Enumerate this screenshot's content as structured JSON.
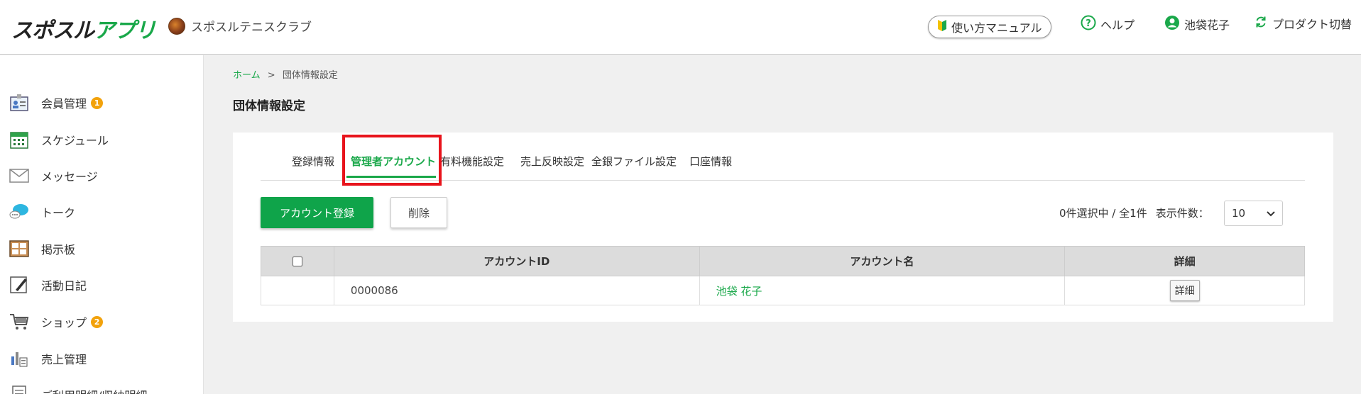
{
  "header": {
    "logo_main": "スポスル",
    "logo_accent": "アプリ",
    "club_name": "スポスルテニスクラブ",
    "manual_label": "使い方マニュアル",
    "help_label": "ヘルプ",
    "user_name": "池袋花子",
    "switch_label": "プロダクト切替"
  },
  "sidebar": {
    "items": [
      {
        "label": "会員管理",
        "badge": "1",
        "icon": "member-card-icon"
      },
      {
        "label": "スケジュール",
        "icon": "calendar-icon"
      },
      {
        "label": "メッセージ",
        "icon": "envelope-icon"
      },
      {
        "label": "トーク",
        "icon": "chat-bubble-icon"
      },
      {
        "label": "掲示板",
        "icon": "bulletin-board-icon"
      },
      {
        "label": "活動日記",
        "icon": "diary-icon"
      },
      {
        "label": "ショップ",
        "badge": "2",
        "icon": "cart-icon"
      },
      {
        "label": "売上管理",
        "icon": "sales-chart-icon"
      },
      {
        "label": "ご利用明細/収納明細",
        "icon": "receipt-icon"
      }
    ]
  },
  "breadcrumb": {
    "home": "ホーム",
    "separator": ">",
    "current": "団体情報設定"
  },
  "page": {
    "title": "団体情報設定"
  },
  "tabs": [
    {
      "label": "登録情報"
    },
    {
      "label": "管理者アカウント"
    },
    {
      "label": "有料機能設定"
    },
    {
      "label": "売上反映設定"
    },
    {
      "label": "全銀ファイル設定"
    },
    {
      "label": "口座情報"
    }
  ],
  "toolbar": {
    "register_label": "アカウント登録",
    "delete_label": "削除",
    "selection_count": "0件選択中 / 全1件",
    "per_page_label": "表示件数：",
    "per_page_value": "10"
  },
  "table": {
    "headers": {
      "id": "アカウントID",
      "name": "アカウント名",
      "detail": "詳細"
    },
    "rows": [
      {
        "id": "0000086",
        "name": "池袋 花子",
        "detail_label": "詳細"
      }
    ]
  },
  "colors": {
    "accent": "#1aa84a",
    "highlight": "#e8141c",
    "badge": "#f2a20c"
  }
}
